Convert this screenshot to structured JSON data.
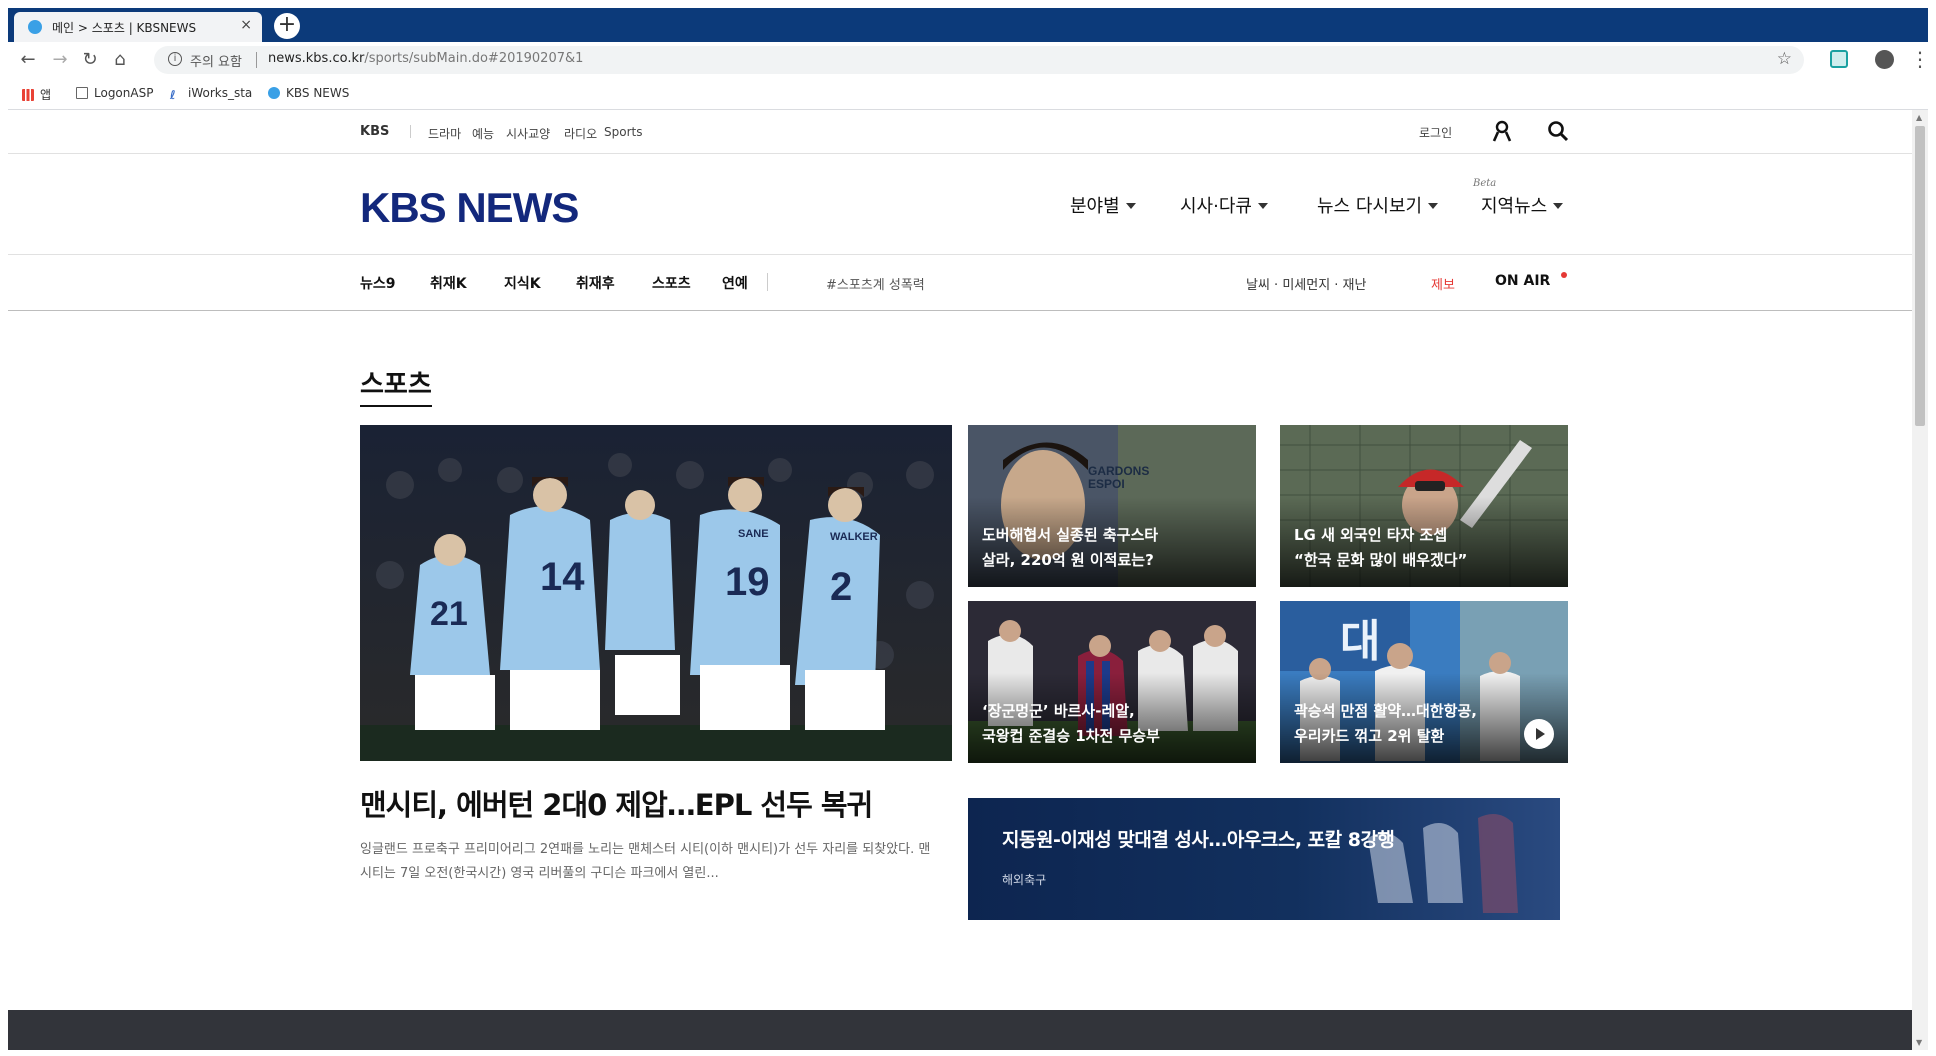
{
  "browser": {
    "tab_title": "메인 > 스포츠 | KBSNEWS",
    "tab_close": "×",
    "new_tab": "+",
    "security_label": "주의 요함",
    "url_host": "news.kbs.co.kr",
    "url_path": "/sports/subMain.do#20190207&1",
    "bookmarks": [
      {
        "label": "앱",
        "icon": "apps-icon"
      },
      {
        "label": "LogonASP",
        "icon": "page-icon"
      },
      {
        "label": "iWorks_sta",
        "icon": "iworks-icon"
      },
      {
        "label": "KBS NEWS",
        "icon": "kbs-icon"
      }
    ]
  },
  "util": {
    "brand": "KBS",
    "links": [
      "드라마",
      "예능",
      "시사교양",
      "라디오",
      "Sports"
    ],
    "login": "로그인"
  },
  "header": {
    "logo": "KBS NEWS",
    "nav": [
      "분야별",
      "시사·다큐",
      "뉴스 다시보기",
      "지역뉴스"
    ],
    "beta": "Beta"
  },
  "subnav": {
    "items": [
      "뉴스9",
      "취재K",
      "지식K",
      "취재후",
      "스포츠",
      "연예"
    ],
    "hashtag": "#스포츠계 성폭력",
    "weather": "날씨 · 미세먼지 · 재난",
    "tip": "제보",
    "onair": "ON AIR"
  },
  "section": {
    "title": "스포츠"
  },
  "main_story": {
    "headline": "맨시티, 에버턴 2대0 제압…EPL 선두 복귀",
    "summary": "잉글랜드 프로축구 프리미어리그 2연패를 노리는 맨체스터 시티(이하 맨시티)가 선두 자리를 되찾았다. 맨시티는 7일 오전(한국시간) 영국 리버풀의 구디슨 파크에서 열린...",
    "jersey_numbers": [
      "21",
      "14",
      "19",
      "2"
    ],
    "jersey_names": [
      "SANE",
      "WALKER"
    ]
  },
  "thumbs": [
    {
      "caption": "도버해협서 실종된 축구스타\n살라, 220억 원 이적료는?",
      "bg_text": "GARDONS\nESPOI"
    },
    {
      "caption": "LG 새 외국인 타자 조셉\n“한국 문화 많이 배우겠다”"
    },
    {
      "caption": "‘장군멍군’ 바르사-레알,\n국왕컵 준결승 1차전 무승부"
    },
    {
      "caption": "곽승석 만점 활약…대한항공,\n우리카드 꺾고 2위 탈환",
      "bg_text": "대"
    }
  ],
  "banner": {
    "title": "지동원-이재성 맞대결 성사…아우크스, 포칼 8강행",
    "category": "해외축구"
  },
  "colors": {
    "tabbar": "#0c3a7a",
    "logo": "#13287c",
    "accent_red": "#e53935",
    "banner": "#0f2a55",
    "footer": "#32343a"
  }
}
